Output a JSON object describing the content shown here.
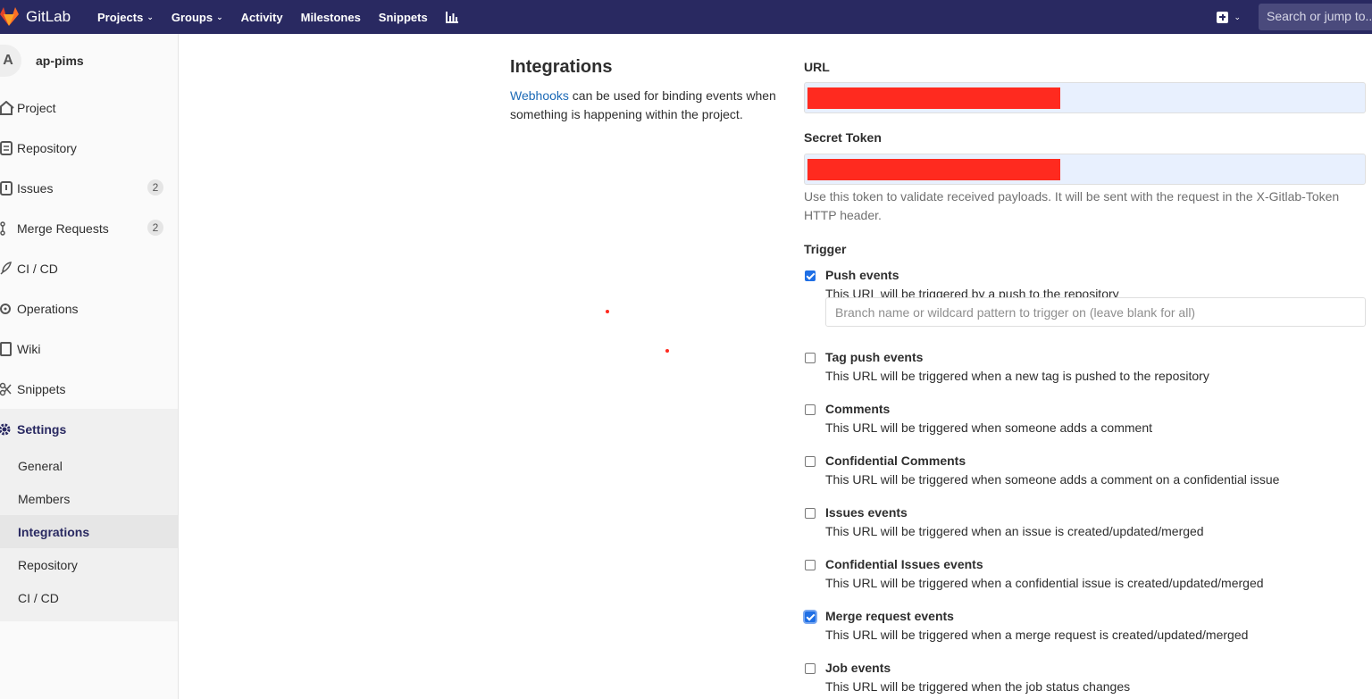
{
  "navbar": {
    "brand": "GitLab",
    "links": [
      "Projects",
      "Groups",
      "Activity",
      "Milestones",
      "Snippets"
    ],
    "search_placeholder": "Search or jump to..."
  },
  "sidebar": {
    "avatar_letter": "A",
    "project_name": "ap-pims",
    "items": [
      {
        "label": "Project",
        "icon": "home-icon"
      },
      {
        "label": "Repository",
        "icon": "doc-icon"
      },
      {
        "label": "Issues",
        "icon": "issues-icon",
        "count": "2"
      },
      {
        "label": "Merge Requests",
        "icon": "merge-request-icon",
        "count": "2"
      },
      {
        "label": "CI / CD",
        "icon": "rocket-icon"
      },
      {
        "label": "Operations",
        "icon": "cloud-gear-icon"
      },
      {
        "label": "Wiki",
        "icon": "book-icon"
      },
      {
        "label": "Snippets",
        "icon": "scissors-icon"
      },
      {
        "label": "Settings",
        "icon": "gear-icon"
      }
    ],
    "settings_sub": [
      "General",
      "Members",
      "Integrations",
      "Repository",
      "CI / CD"
    ]
  },
  "intro": {
    "title": "Integrations",
    "link": "Webhooks",
    "text": " can be used for binding events when something is happening within the project."
  },
  "form": {
    "url_label": "URL",
    "token_label": "Secret Token",
    "token_help": "Use this token to validate received payloads. It will be sent with the request in the X-Gitlab-Token HTTP header.",
    "trigger_label": "Trigger",
    "branch_placeholder": "Branch name or wildcard pattern to trigger on (leave blank for all)",
    "triggers": [
      {
        "title": "Push events",
        "desc": "This URL will be triggered by a push to the repository",
        "checked": true
      },
      {
        "title": "Tag push events",
        "desc": "This URL will be triggered when a new tag is pushed to the repository",
        "checked": false
      },
      {
        "title": "Comments",
        "desc": "This URL will be triggered when someone adds a comment",
        "checked": false
      },
      {
        "title": "Confidential Comments",
        "desc": "This URL will be triggered when someone adds a comment on a confidential issue",
        "checked": false
      },
      {
        "title": "Issues events",
        "desc": "This URL will be triggered when an issue is created/updated/merged",
        "checked": false
      },
      {
        "title": "Confidential Issues events",
        "desc": "This URL will be triggered when a confidential issue is created/updated/merged",
        "checked": false
      },
      {
        "title": "Merge request events",
        "desc": "This URL will be triggered when a merge request is created/updated/merged",
        "checked": true
      },
      {
        "title": "Job events",
        "desc": "This URL will be triggered when the job status changes",
        "checked": false
      }
    ]
  }
}
